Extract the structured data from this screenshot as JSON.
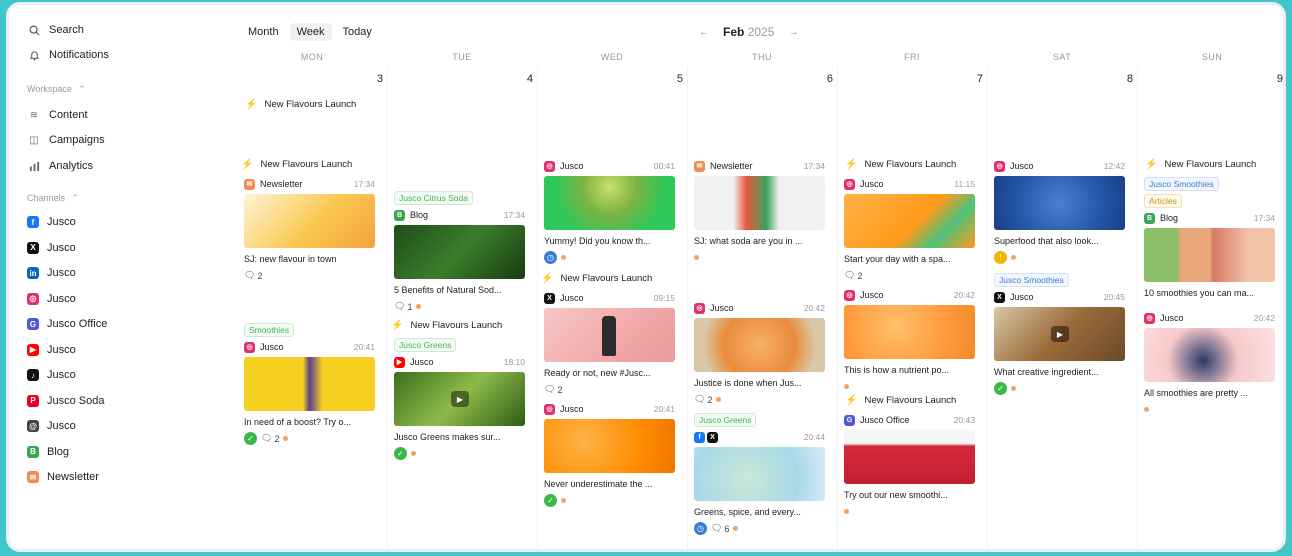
{
  "sidebar": {
    "search": "Search",
    "notifications": "Notifications",
    "workspace_label": "Workspace",
    "workspace_items": [
      "Content",
      "Campaigns",
      "Analytics"
    ],
    "channels_label": "Channels",
    "channels": [
      {
        "label": "Jusco",
        "icon": "facebook-icon",
        "color": "#1877f2",
        "glyph": "f"
      },
      {
        "label": "Jusco",
        "icon": "x-icon",
        "color": "#111111",
        "glyph": "X"
      },
      {
        "label": "Jusco",
        "icon": "linkedin-icon",
        "color": "#0a66c2",
        "glyph": "in"
      },
      {
        "label": "Jusco",
        "icon": "instagram-icon",
        "color": "#e1306c",
        "glyph": "◎"
      },
      {
        "label": "Jusco Office",
        "icon": "google-business-icon",
        "color": "#4e5ad7",
        "glyph": "G"
      },
      {
        "label": "Jusco",
        "icon": "youtube-icon",
        "color": "#ff0000",
        "glyph": "▶"
      },
      {
        "label": "Jusco",
        "icon": "tiktok-icon",
        "color": "#111111",
        "glyph": "♪"
      },
      {
        "label": "Jusco Soda",
        "icon": "pinterest-icon",
        "color": "#e60023",
        "glyph": "P"
      },
      {
        "label": "Jusco",
        "icon": "threads-icon",
        "color": "#444444",
        "glyph": "@"
      },
      {
        "label": "Blog",
        "icon": "blog-icon",
        "color": "#34a853",
        "glyph": "B"
      },
      {
        "label": "Newsletter",
        "icon": "newsletter-icon",
        "color": "#f28b50",
        "glyph": "✉"
      }
    ]
  },
  "toolbar": {
    "month": "Month",
    "week": "Week",
    "today": "Today",
    "prev": "←",
    "next": "→",
    "month_name": "Feb",
    "year": "2025"
  },
  "days": [
    {
      "name": "MON",
      "date": "3"
    },
    {
      "name": "TUE",
      "date": "4"
    },
    {
      "name": "WED",
      "date": "5"
    },
    {
      "name": "THU",
      "date": "6"
    },
    {
      "name": "FRI",
      "date": "7"
    },
    {
      "name": "SAT",
      "date": "8"
    },
    {
      "name": "SUN",
      "date": "9"
    }
  ],
  "events": {
    "launch": "New Flavours Launch"
  },
  "posts": {
    "mon1": {
      "name": "Newsletter",
      "time": "17:34",
      "caption": "SJ: new flavour in town",
      "comments": "2"
    },
    "mon2": {
      "tag": "Smoothies",
      "name": "Jusco",
      "time": "20:41",
      "caption": "In need of a boost? Try o...",
      "comments": "2"
    },
    "tue1": {
      "tag": "Jusco Citrus Soda",
      "name": "Blog",
      "time": "17:34",
      "caption": "5 Benefits of Natural Sod...",
      "comments": "1"
    },
    "tue2": {
      "tag": "Jusco Greens",
      "name": "Jusco",
      "time": "18:10",
      "caption": "Jusco Greens makes sur..."
    },
    "wed1": {
      "name": "Jusco",
      "time": "00:41",
      "caption": "Yummy! Did you know th..."
    },
    "wed2": {
      "name": "Jusco",
      "time": "09:15",
      "caption": "Ready or not, new #Jusc...",
      "comments": "2"
    },
    "wed3": {
      "name": "Jusco",
      "time": "20:41",
      "caption": "Never underestimate the ..."
    },
    "thu1": {
      "name": "Newsletter",
      "time": "17:34",
      "caption": "SJ: what soda are you in ..."
    },
    "thu2": {
      "name": "Jusco",
      "time": "20:42",
      "caption": "Justice is done when Jus...",
      "comments": "2"
    },
    "thu3": {
      "tag": "Jusco Greens",
      "time": "20:44",
      "caption": "Greens, spice, and every...",
      "comments": "6"
    },
    "fri1": {
      "name": "Jusco",
      "time": "11:15",
      "caption": "Start your day with a spa...",
      "comments": "2"
    },
    "fri2": {
      "name": "Jusco",
      "time": "20:42",
      "caption": "This is how a nutrient po..."
    },
    "fri3": {
      "name": "Jusco Office",
      "time": "20:43",
      "caption": "Try out our new smoothi..."
    },
    "sat1": {
      "name": "Jusco",
      "time": "12:42",
      "caption": "Superfood that also look..."
    },
    "sat2": {
      "tag": "Jusco Smoothies",
      "name": "Jusco",
      "time": "20:45",
      "caption": "What creative ingredient..."
    },
    "sun1": {
      "tag": "Jusco Smoothies",
      "tag2": "Articles",
      "name": "Blog",
      "time": "17:34",
      "caption": "10 smoothies you can ma..."
    },
    "sun2": {
      "name": "Jusco",
      "time": "20:42",
      "caption": "All smoothies are pretty ..."
    }
  },
  "colors": {
    "accent": "#34c3c6",
    "approved": "#3cb84a",
    "scheduled": "#3a7bd5",
    "warning": "#f4b400",
    "draft_dot": "#f4a261"
  }
}
